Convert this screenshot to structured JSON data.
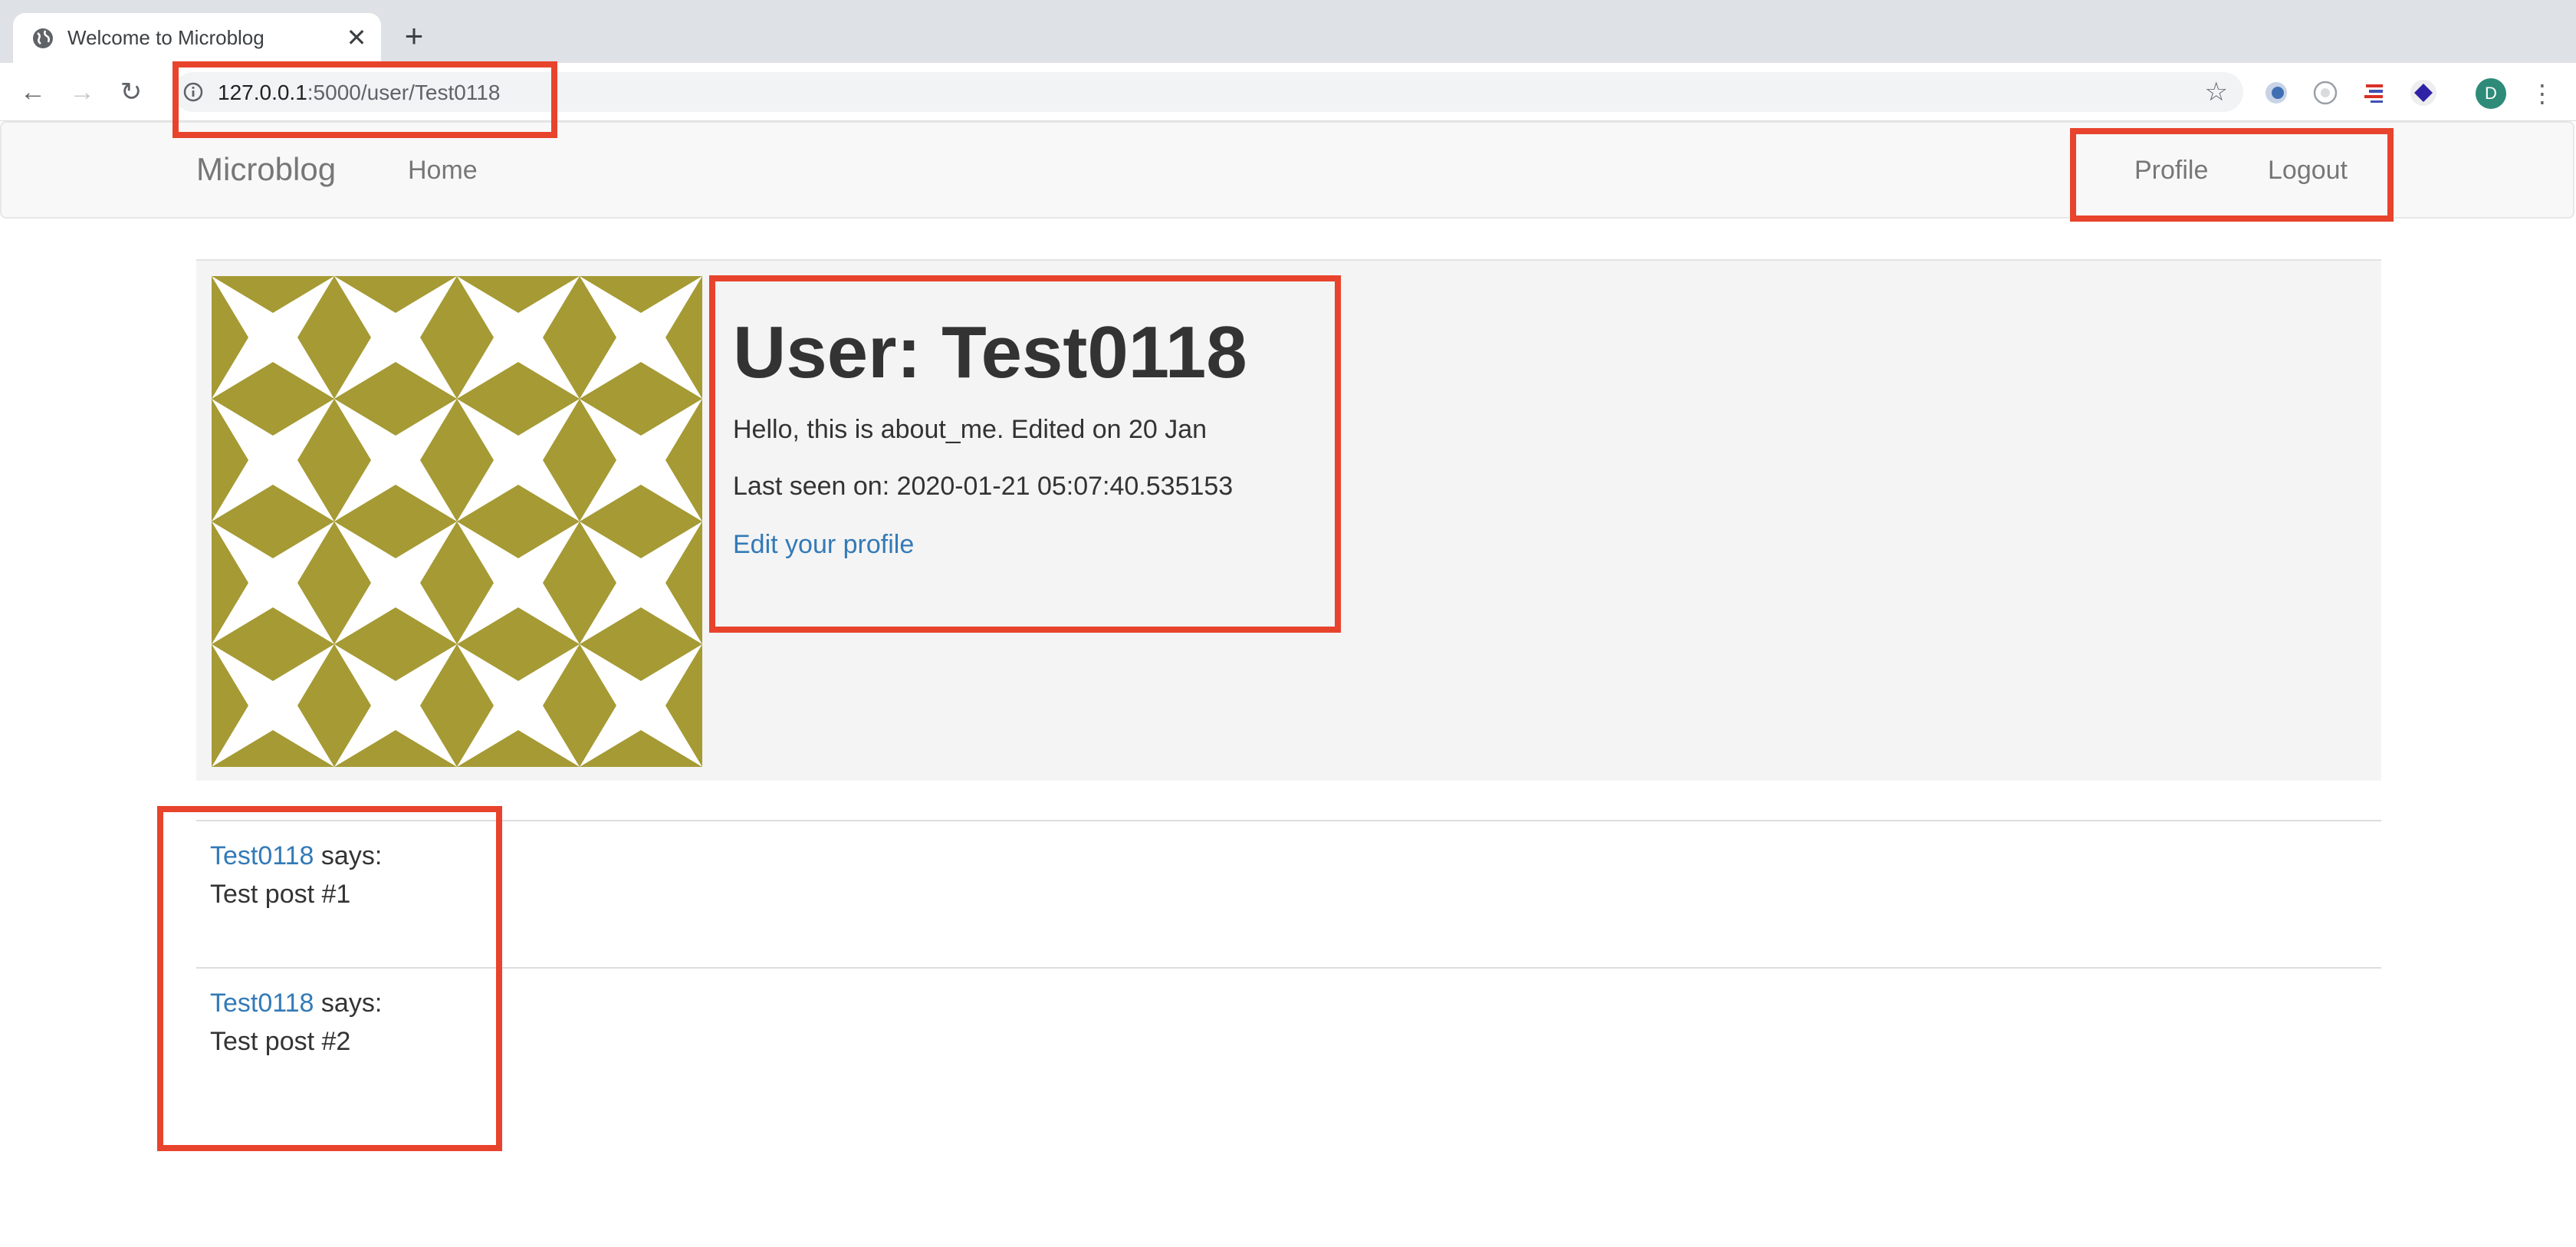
{
  "browser": {
    "tab_title": "Welcome to Microblog",
    "new_tab_label": "+",
    "close_tab_label": "✕",
    "url_host": "127.0.0.1",
    "url_path": ":5000/user/Test0118",
    "back_label": "←",
    "forward_label": "→",
    "reload_label": "↻",
    "star_label": "☆",
    "profile_initial": "D",
    "menu_label": "⋮"
  },
  "navbar": {
    "brand": "Microblog",
    "home": "Home",
    "profile": "Profile",
    "logout": "Logout"
  },
  "profile": {
    "heading": "User: Test0118",
    "about_me": "Hello, this is about_me. Edited on 20 Jan",
    "last_seen": "Last seen on: 2020-01-21 05:07:40.535153",
    "edit_link": "Edit your profile",
    "avatar_color": "#a59a34"
  },
  "posts": [
    {
      "author": "Test0118",
      "says": "says:",
      "body": "Test post #1"
    },
    {
      "author": "Test0118",
      "says": "says:",
      "body": "Test post #2"
    }
  ],
  "colors": {
    "highlight": "#e8432c",
    "link": "#337ab7"
  }
}
